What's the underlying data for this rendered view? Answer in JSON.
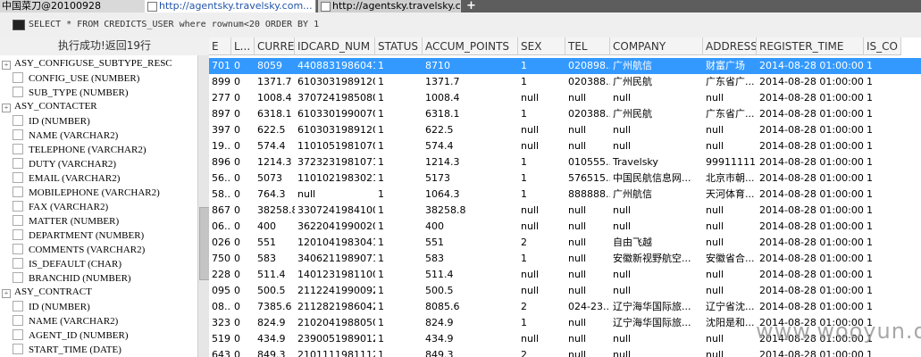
{
  "window": {
    "title": "中国菜刀@20100928"
  },
  "tabs": [
    {
      "label": "http://agentsky.travelsky.com...",
      "active": true
    },
    {
      "label": "http://agentsky.travelsky.com...",
      "active": false
    }
  ],
  "new_tab_label": "+",
  "sql": {
    "text": "SELECT * FROM CREDICTS_USER where rownum<20 ORDER BY 1"
  },
  "status": {
    "text": "执行成功!返回19行"
  },
  "tree": [
    {
      "kind": "table",
      "label": "ASY_CONFIGUSE_SUBTYPE_RESC"
    },
    {
      "kind": "column",
      "label": "CONFIG_USE (NUMBER)"
    },
    {
      "kind": "column",
      "label": "SUB_TYPE (NUMBER)"
    },
    {
      "kind": "table",
      "label": "ASY_CONTACTER"
    },
    {
      "kind": "column",
      "label": "ID (NUMBER)"
    },
    {
      "kind": "column",
      "label": "NAME (VARCHAR2)"
    },
    {
      "kind": "column",
      "label": "TELEPHONE (VARCHAR2)"
    },
    {
      "kind": "column",
      "label": "DUTY (VARCHAR2)"
    },
    {
      "kind": "column",
      "label": "EMAIL (VARCHAR2)"
    },
    {
      "kind": "column",
      "label": "MOBILEPHONE (VARCHAR2)"
    },
    {
      "kind": "column",
      "label": "FAX (VARCHAR2)"
    },
    {
      "kind": "column",
      "label": "MATTER (NUMBER)"
    },
    {
      "kind": "column",
      "label": "DEPARTMENT (NUMBER)"
    },
    {
      "kind": "column",
      "label": "COMMENTS (VARCHAR2)"
    },
    {
      "kind": "column",
      "label": "IS_DEFAULT (CHAR)"
    },
    {
      "kind": "column",
      "label": "BRANCHID (NUMBER)"
    },
    {
      "kind": "table",
      "label": "ASY_CONTRACT"
    },
    {
      "kind": "column",
      "label": "ID (NUMBER)"
    },
    {
      "kind": "column",
      "label": "NAME (VARCHAR2)"
    },
    {
      "kind": "column",
      "label": "AGENT_ID (NUMBER)"
    },
    {
      "kind": "column",
      "label": "START_TIME (DATE)"
    }
  ],
  "grid": {
    "headers": [
      "E",
      "L...",
      "CURRE...",
      "IDCARD_NUM",
      "STATUS",
      "ACCUM_POINTS",
      "SEX",
      "TEL",
      "COMPANY",
      "ADDRESS",
      "REGISTER_TIME",
      "IS_CO"
    ],
    "rows": [
      [
        "701...",
        "0",
        "8059",
        "440883198604170...",
        "1",
        "8710",
        "1",
        "020898...",
        "广州航信",
        "财富广场",
        "2014-08-28 01:00:00.0",
        "1"
      ],
      [
        "899...",
        "0",
        "1371.7",
        "610303198912053...",
        "1",
        "1371.7",
        "1",
        "020388...",
        "广州民航",
        "广东省广...",
        "2014-08-28 01:00:00.0",
        "1"
      ],
      [
        "277...",
        "0",
        "1008.4",
        "370724198508052...",
        "1",
        "1008.4",
        "null",
        "null",
        "null",
        "null",
        "2014-08-28 01:00:00.0",
        "1"
      ],
      [
        "897...",
        "0",
        "6318.1",
        "610330199007021...",
        "1",
        "6318.1",
        "1",
        "020388...",
        "广州民航",
        "广东省广...",
        "2014-08-28 01:00:00.0",
        "1"
      ],
      [
        "397...",
        "0",
        "622.5",
        "610303198912054...",
        "1",
        "622.5",
        "null",
        "null",
        "null",
        "null",
        "2014-08-28 01:00:00.0",
        "1"
      ],
      [
        "19...",
        "0",
        "574.4",
        "110105198107071...",
        "1",
        "574.4",
        "null",
        "null",
        "null",
        "null",
        "2014-08-28 01:00:00.0",
        "1"
      ],
      [
        "896...",
        "0",
        "1214.3",
        "372323198107160...",
        "1",
        "1214.3",
        "1",
        "010555...",
        "Travelsky",
        "999111111",
        "2014-08-28 01:00:00.0",
        "1"
      ],
      [
        "56...",
        "0",
        "5073",
        "110102198302152...",
        "1",
        "5173",
        "1",
        "576515...",
        "中国民航信息网...",
        "北京市朝...",
        "2014-08-28 01:00:00.0",
        "1"
      ],
      [
        "58...",
        "0",
        "764.3",
        "null",
        "1",
        "1064.3",
        "1",
        "888888...",
        "广州航信",
        "天河体育...",
        "2014-08-28 01:00:00.0",
        "1"
      ],
      [
        "867...",
        "0",
        "38258.8",
        "330724198410065...",
        "1",
        "38258.8",
        "null",
        "null",
        "null",
        "null",
        "2014-08-28 01:00:00.0",
        "1"
      ],
      [
        "06...",
        "0",
        "400",
        "362204199002061...",
        "1",
        "400",
        "null",
        "null",
        "null",
        "null",
        "2014-08-28 01:00:00.0",
        "1"
      ],
      [
        "026...",
        "0",
        "551",
        "120104198304122...",
        "1",
        "551",
        "2",
        "null",
        "自由飞越",
        "null",
        "2014-08-28 01:00:00.0",
        "1"
      ],
      [
        "750...",
        "0",
        "583",
        "340621198907166...",
        "1",
        "583",
        "1",
        "null",
        "安徽新视野航空...",
        "安徽省合...",
        "2014-08-28 01:00:00.0",
        "1"
      ],
      [
        "228...",
        "0",
        "511.4",
        "140123198110091...",
        "1",
        "511.4",
        "null",
        "null",
        "null",
        "null",
        "2014-08-28 01:00:00.0",
        "1"
      ],
      [
        "095...",
        "0",
        "500.5",
        "211224199009229...",
        "1",
        "500.5",
        "null",
        "null",
        "null",
        "null",
        "2014-08-28 01:00:00.0",
        "1"
      ],
      [
        "08...",
        "0",
        "7385.6",
        "211282198604273...",
        "1",
        "8085.6",
        "2",
        "024-23...",
        "辽宁海华国际旅...",
        "辽宁省沈...",
        "2014-08-28 01:00:00.0",
        "1"
      ],
      [
        "323...",
        "0",
        "824.9",
        "210204198805063...",
        "1",
        "824.9",
        "1",
        "null",
        "辽宁海华国际旅...",
        "沈阳是和...",
        "2014-08-28 01:00:00.0",
        "1"
      ],
      [
        "519...",
        "0",
        "434.9",
        "239005198901290...",
        "1",
        "434.9",
        "null",
        "null",
        "null",
        "null",
        "2014-08-28 01:00:00.0",
        "1"
      ],
      [
        "643...",
        "0",
        "849.3",
        "210111198111291...",
        "1",
        "849.3",
        "2",
        "null",
        "null",
        "null",
        "2014-08-28 01:00:00.0",
        "1"
      ]
    ]
  },
  "watermark": {
    "text": "www.wooyun.org"
  }
}
